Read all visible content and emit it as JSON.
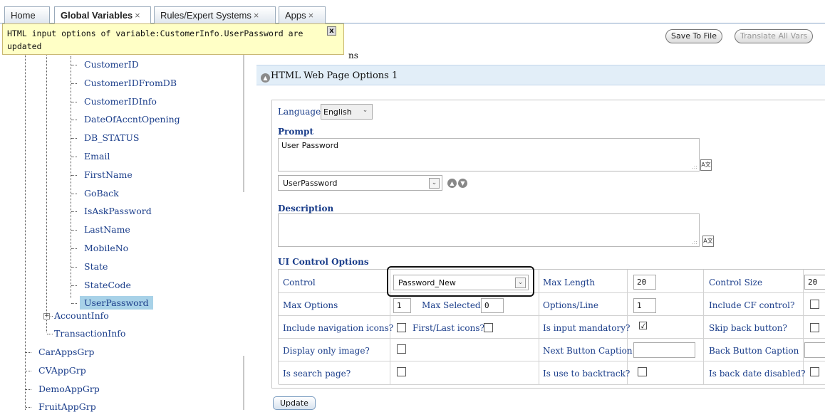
{
  "tabs": [
    {
      "label": "Home",
      "close": ""
    },
    {
      "label": "Global Variables",
      "close": "×"
    },
    {
      "label": "Rules/Expert Systems",
      "close": "×"
    },
    {
      "label": "Apps",
      "close": "×"
    }
  ],
  "tooltip": {
    "text": "HTML input options of variable:CustomerInfo.UserPassword are updated",
    "close": "x"
  },
  "toolbar": {
    "save_to_file": "Save To File",
    "translate_all": "Translate All Vars"
  },
  "tree": {
    "vars": [
      "CustomerID",
      "CustomerIDFromDB",
      "CustomerIDInfo",
      "DateOfAccntOpening",
      "DB_STATUS",
      "Email",
      "FirstName",
      "GoBack",
      "IsAskPassword",
      "LastName",
      "MobileNo",
      "State",
      "StateCode",
      "UserPassword"
    ],
    "groups": [
      "AccountInfo",
      "TransactionInfo"
    ],
    "apps": [
      "CarAppsGrp",
      "CVAppGrp",
      "DemoAppGrp",
      "FruitAppGrp"
    ],
    "partial_label": "ns"
  },
  "section": {
    "title": "HTML Web Page Options 1"
  },
  "form": {
    "language_label": "Language:",
    "language_value": "English",
    "prompt_label": "Prompt",
    "prompt_value": "User Password",
    "variant_value": "UserPassword",
    "description_label": "Description",
    "description_value": "",
    "ui_label": "UI Control Options",
    "control_label": "Control",
    "control_value": "Password_New",
    "max_length_label": "Max Length",
    "max_length_value": "20",
    "control_size_label": "Control Size",
    "control_size_value": "20",
    "max_options_label": "Max Options",
    "max_options_value": "1",
    "max_selected_label": "Max Selected:",
    "max_selected_value": "0",
    "options_line_label": "Options/Line",
    "options_line_value": "1",
    "include_cf_label": "Include CF control?",
    "nav_icons_label": "Include navigation icons?",
    "first_last_label": "First/Last icons?",
    "mandatory_label": "Is input mandatory?",
    "mandatory_checked": "☑",
    "skip_back_label": "Skip back button?",
    "display_image_label": "Display only image?",
    "next_caption_label": "Next Button Caption",
    "next_caption_value": "",
    "back_caption_label": "Back Button Caption",
    "back_caption_value": "",
    "search_page_label": "Is search page?",
    "backtrack_label": "Is use to backtrack?",
    "back_date_label": "Is back date disabled?",
    "update_label": "Update"
  },
  "icons": {
    "collapse": "▲",
    "up": "▲",
    "down": "▼",
    "dropdown": "⌄",
    "translate": "A文",
    "grip": ".::",
    "plus": "+"
  }
}
